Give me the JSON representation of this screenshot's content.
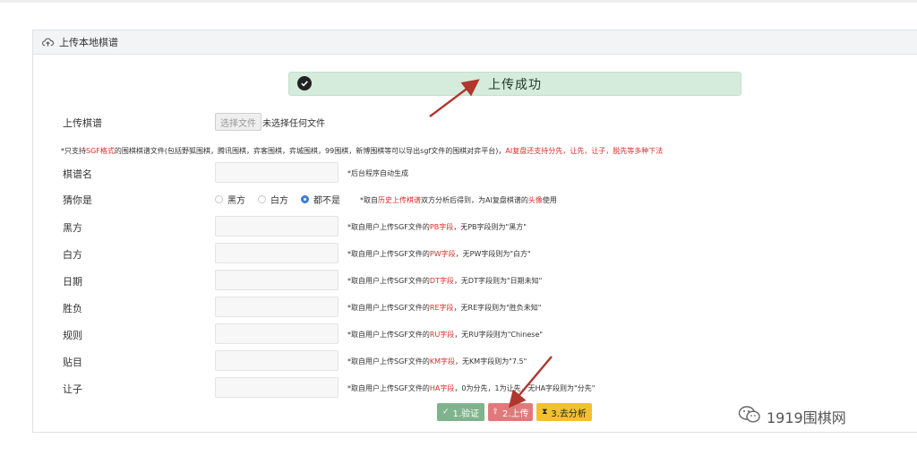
{
  "panel": {
    "title": "上传本地棋谱"
  },
  "alert": {
    "message": "上传成功"
  },
  "upload": {
    "label": "上传棋谱",
    "choose_button": "选择文件",
    "no_file_text": "未选择任何文件"
  },
  "notice": {
    "part1": "*只支持",
    "highlight1": "SGF格式",
    "part2": "的围棋棋谱文件(包括野狐围棋，腾讯围棋，弈客围棋，弈城围棋，99围棋，新博围棋等可以导出sgf文件的围棋对弈平台)，",
    "highlight2": "AI复盘还支持分先，让先，让子，脱先等多种下法"
  },
  "fields": {
    "name": {
      "label": "棋谱名",
      "hint": "*后台程序自动生成"
    },
    "guess": {
      "label": "猜你是",
      "options": [
        "黑方",
        "白方",
        "都不是"
      ],
      "selected": "都不是",
      "hint_pre": "*取自",
      "hint_red1": "历史上传棋谱",
      "hint_mid": "双方分析后得到，为AI复盘棋谱的",
      "hint_red2": "头像",
      "hint_post": "使用"
    },
    "rows": [
      {
        "label": "黑方",
        "pre": "*取自用户上传SGF文件的",
        "field": "PB字段",
        "post": "，无PB字段则为\"黑方\""
      },
      {
        "label": "白方",
        "pre": "*取自用户上传SGF文件的",
        "field": "PW字段",
        "post": "，无PW字段则为\"白方\""
      },
      {
        "label": "日期",
        "pre": "*取自用户上传SGF文件的",
        "field": "DT字段",
        "post": "，无DT字段则为\"日期未知\""
      },
      {
        "label": "胜负",
        "pre": "*取自用户上传SGF文件的",
        "field": "RE字段",
        "post": "，无RE字段则为\"胜负未知\""
      },
      {
        "label": "规则",
        "pre": "*取自用户上传SGF文件的",
        "field": "RU字段",
        "post": "，无RU字段则为\"Chinese\""
      },
      {
        "label": "贴目",
        "pre": "*取自用户上传SGF文件的",
        "field": "KM字段",
        "post": "，无KM字段则为\"7.5\""
      },
      {
        "label": "让子",
        "pre": "*取自用户上传SGF文件的",
        "field": "HA字段",
        "post": "，0为分先，1为让先，无HA字段则为\"分先\""
      }
    ]
  },
  "buttons": {
    "verify": "1.验证",
    "upload": "2.上传",
    "analyze": "3.去分析"
  },
  "colors": {
    "verify_btn": "#7fb38c",
    "upload_btn": "#e07a7a",
    "analyze_btn": "#f2c12e",
    "success_bg": "#d5ebdb",
    "highlight_red": "#d9302c",
    "arrow": "#b0362e"
  },
  "watermark": {
    "text": "1919围棋网"
  }
}
